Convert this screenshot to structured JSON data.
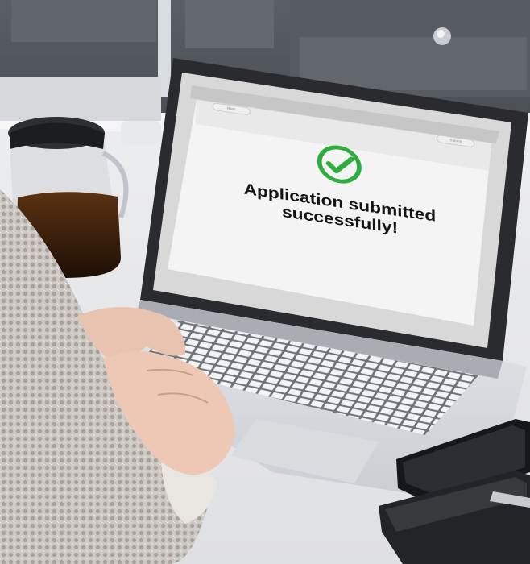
{
  "screen": {
    "back_button_label": "Back",
    "submit_button_label": "Submit",
    "message_line1": "Application submitted",
    "message_line2": "successfully!",
    "success_icon": "check-circle-icon",
    "success_color": "#2fae3f"
  }
}
